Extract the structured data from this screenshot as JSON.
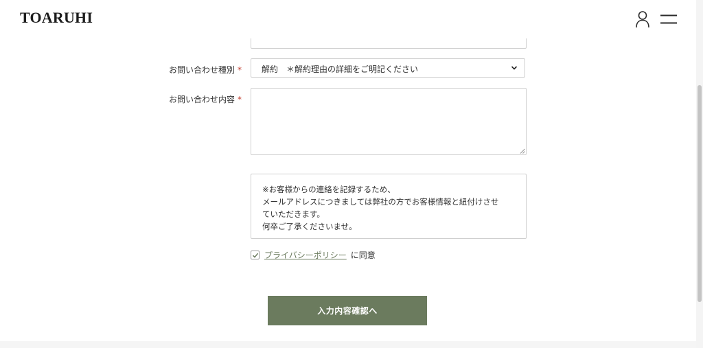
{
  "header": {
    "logo_text": "TOARUHI",
    "icons": [
      "user-icon",
      "hamburger-menu-icon"
    ]
  },
  "form": {
    "inquiry_type": {
      "label": "お問い合わせ種別",
      "required_mark": "*",
      "selected_value": "解約　＊解約理由の詳細をご明記ください"
    },
    "inquiry_content": {
      "label": "お問い合わせ内容",
      "required_mark": "*",
      "value": ""
    },
    "notice_lines": [
      "※お客様からの連絡を記録するため、",
      "メールアドレスにつきましては弊社の方でお客様情報と紐付けさせ",
      "ていただきます。",
      "何卒ご了承くださいませ。"
    ],
    "consent": {
      "checked": true,
      "link_text": "プライバシーポリシー",
      "suffix_text": "に同意"
    },
    "submit_label": "入力内容確認へ"
  },
  "colors": {
    "accent": "#6b7b5e",
    "required": "#c0392b",
    "border": "#cfcfcf",
    "text": "#333333"
  }
}
